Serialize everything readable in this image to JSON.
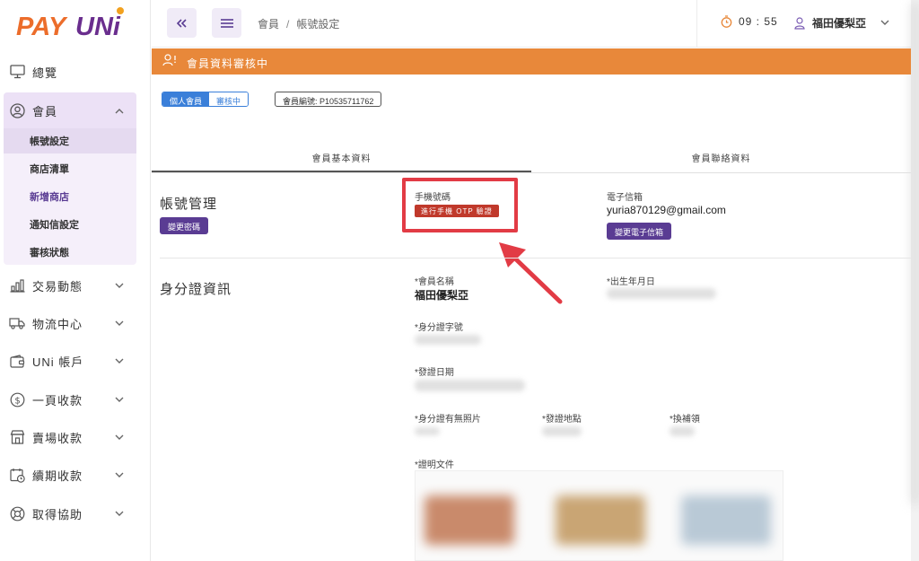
{
  "logo": {
    "pay": "PAY",
    "uni": "UNi"
  },
  "sidebar": {
    "items": [
      {
        "label": "總覽",
        "icon": "monitor-icon"
      },
      {
        "label": "會員",
        "icon": "user-circle-icon"
      },
      {
        "label": "交易動態",
        "icon": "bar-chart-icon"
      },
      {
        "label": "物流中心",
        "icon": "truck-icon"
      },
      {
        "label": "UNi 帳戶",
        "icon": "wallet-icon"
      },
      {
        "label": "一頁收款",
        "icon": "dollar-coin-icon"
      },
      {
        "label": "賣場收款",
        "icon": "store-icon"
      },
      {
        "label": "續期收款",
        "icon": "calendar-clock-icon"
      },
      {
        "label": "取得協助",
        "icon": "lifebuoy-icon"
      }
    ],
    "member_sub": [
      "帳號設定",
      "商店清單",
      "新增商店",
      "通知信設定",
      "審核狀態"
    ]
  },
  "header": {
    "breadcrumb": [
      "會員",
      "帳號設定"
    ],
    "timer": "09 : 55",
    "user_name": "福田優梨亞"
  },
  "banner": {
    "text": "會員資料審核中"
  },
  "badges": {
    "type": "個人會員",
    "status": "審核中",
    "member_id": "會員編號: P10535711762"
  },
  "tabs": [
    "會員基本資料",
    "會員聯絡資料"
  ],
  "account": {
    "title": "帳號管理",
    "change_password": "變更密碼",
    "phone_label": "手機號碼",
    "otp_button": "進行手機 OTP 驗證",
    "email_label": "電子信箱",
    "email_value": "yuria870129@gmail.com",
    "change_email": "變更電子信箱"
  },
  "identity": {
    "title": "身分證資訊",
    "name_label": "*會員名稱",
    "name_value": "福田優梨亞",
    "birth_label": "*出生年月日",
    "id_label": "*身分證字號",
    "issue_date_label": "*發證日期",
    "photo_label": "*身分證有無照片",
    "issue_place_label": "*發證地點",
    "reissue_label": "*換補領",
    "docs_label": "*證明文件"
  },
  "colors": {
    "brand_orange": "#e8883a",
    "brand_purple": "#5a3c93",
    "highlight_red": "#e23b45"
  }
}
